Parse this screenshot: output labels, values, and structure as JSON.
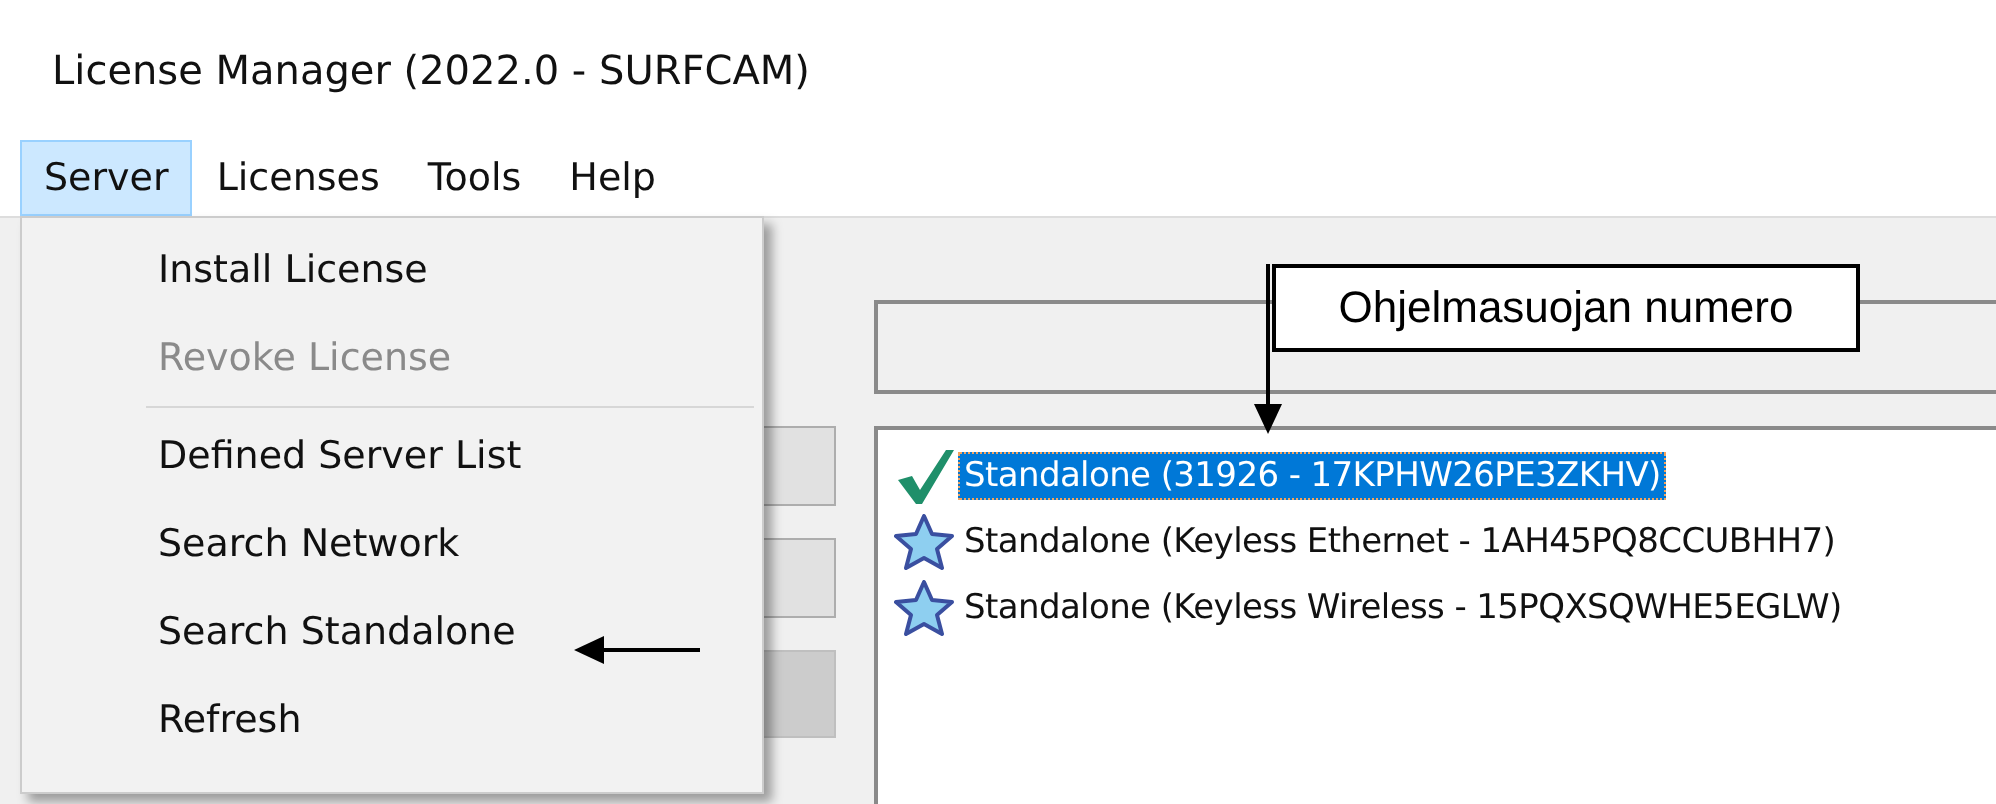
{
  "window": {
    "title": "License Manager (2022.0 - SURFCAM)"
  },
  "menu_bar": [
    {
      "label": "Server",
      "selected": true
    },
    {
      "label": "Licenses",
      "selected": false
    },
    {
      "label": "Tools",
      "selected": false
    },
    {
      "label": "Help",
      "selected": false
    }
  ],
  "server_menu": [
    {
      "kind": "item",
      "label": "Install License",
      "disabled": false
    },
    {
      "kind": "item",
      "label": "Revoke License",
      "disabled": true
    },
    {
      "kind": "separator"
    },
    {
      "kind": "item",
      "label": "Defined Server List",
      "disabled": false
    },
    {
      "kind": "item",
      "label": "Search Network",
      "disabled": false
    },
    {
      "kind": "item",
      "label": "Search Standalone",
      "disabled": false
    },
    {
      "kind": "item",
      "label": "Refresh",
      "disabled": false
    }
  ],
  "side_buttons": [
    {
      "disabled": false
    },
    {
      "disabled": false
    },
    {
      "disabled": true
    }
  ],
  "license_list": [
    {
      "kind": "active",
      "label": "Standalone (31926 - 17KPHW26PE3ZKHV)",
      "selected": true
    },
    {
      "kind": "keyless",
      "label": "Standalone (Keyless Ethernet - 1AH45PQ8CCUBHH7)",
      "selected": false
    },
    {
      "kind": "keyless",
      "label": "Standalone (Keyless Wireless - 15PQXSQWHE5EGLW)",
      "selected": false
    }
  ],
  "annotations": [
    {
      "kind": "callout",
      "text": "Ohjelmasuojan numero"
    },
    {
      "kind": "arrow"
    }
  ]
}
